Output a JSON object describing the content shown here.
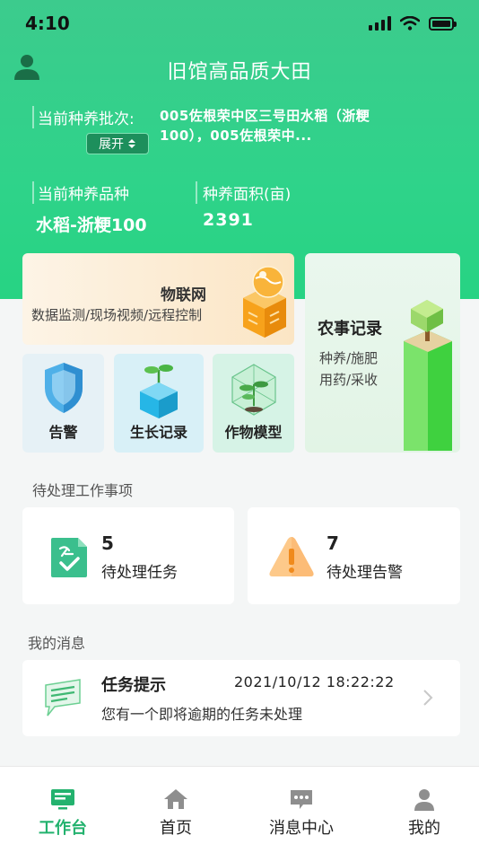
{
  "status_bar": {
    "time": "4:10"
  },
  "header": {
    "title": "旧馆高品质大田",
    "batch_label": "当前种养批次:",
    "expand_label": "展开",
    "batch_value": "005佐根荣中区三号田水稻（浙粳100），005佐根荣中...",
    "variety_label": "当前种养品种",
    "variety_value": "水稻-浙粳100",
    "area_label": "种养面积(亩)",
    "area_value": "2391"
  },
  "modules": {
    "iot": {
      "title": "物联网",
      "subtitle": "数据监测/现场视频/远程控制"
    },
    "farm": {
      "title": "农事记录",
      "sub1": "种养/施肥",
      "sub2": "用药/采收"
    },
    "alarm": {
      "label": "告警"
    },
    "growth": {
      "label": "生长记录"
    },
    "crop": {
      "label": "作物模型"
    }
  },
  "pending": {
    "title": "待处理工作事项",
    "tasks": {
      "count": "5",
      "label": "待处理任务"
    },
    "alarms": {
      "count": "7",
      "label": "待处理告警"
    }
  },
  "messages": {
    "title": "我的消息",
    "item": {
      "name": "任务提示",
      "time": "2021/10/12 18:22:22",
      "text": "您有一个即将逾期的任务未处理"
    }
  },
  "tabbar": {
    "work": "工作台",
    "home": "首页",
    "msg": "消息中心",
    "mine": "我的"
  },
  "colors": {
    "brand": "#23b26e",
    "header": "#2fd38a"
  }
}
